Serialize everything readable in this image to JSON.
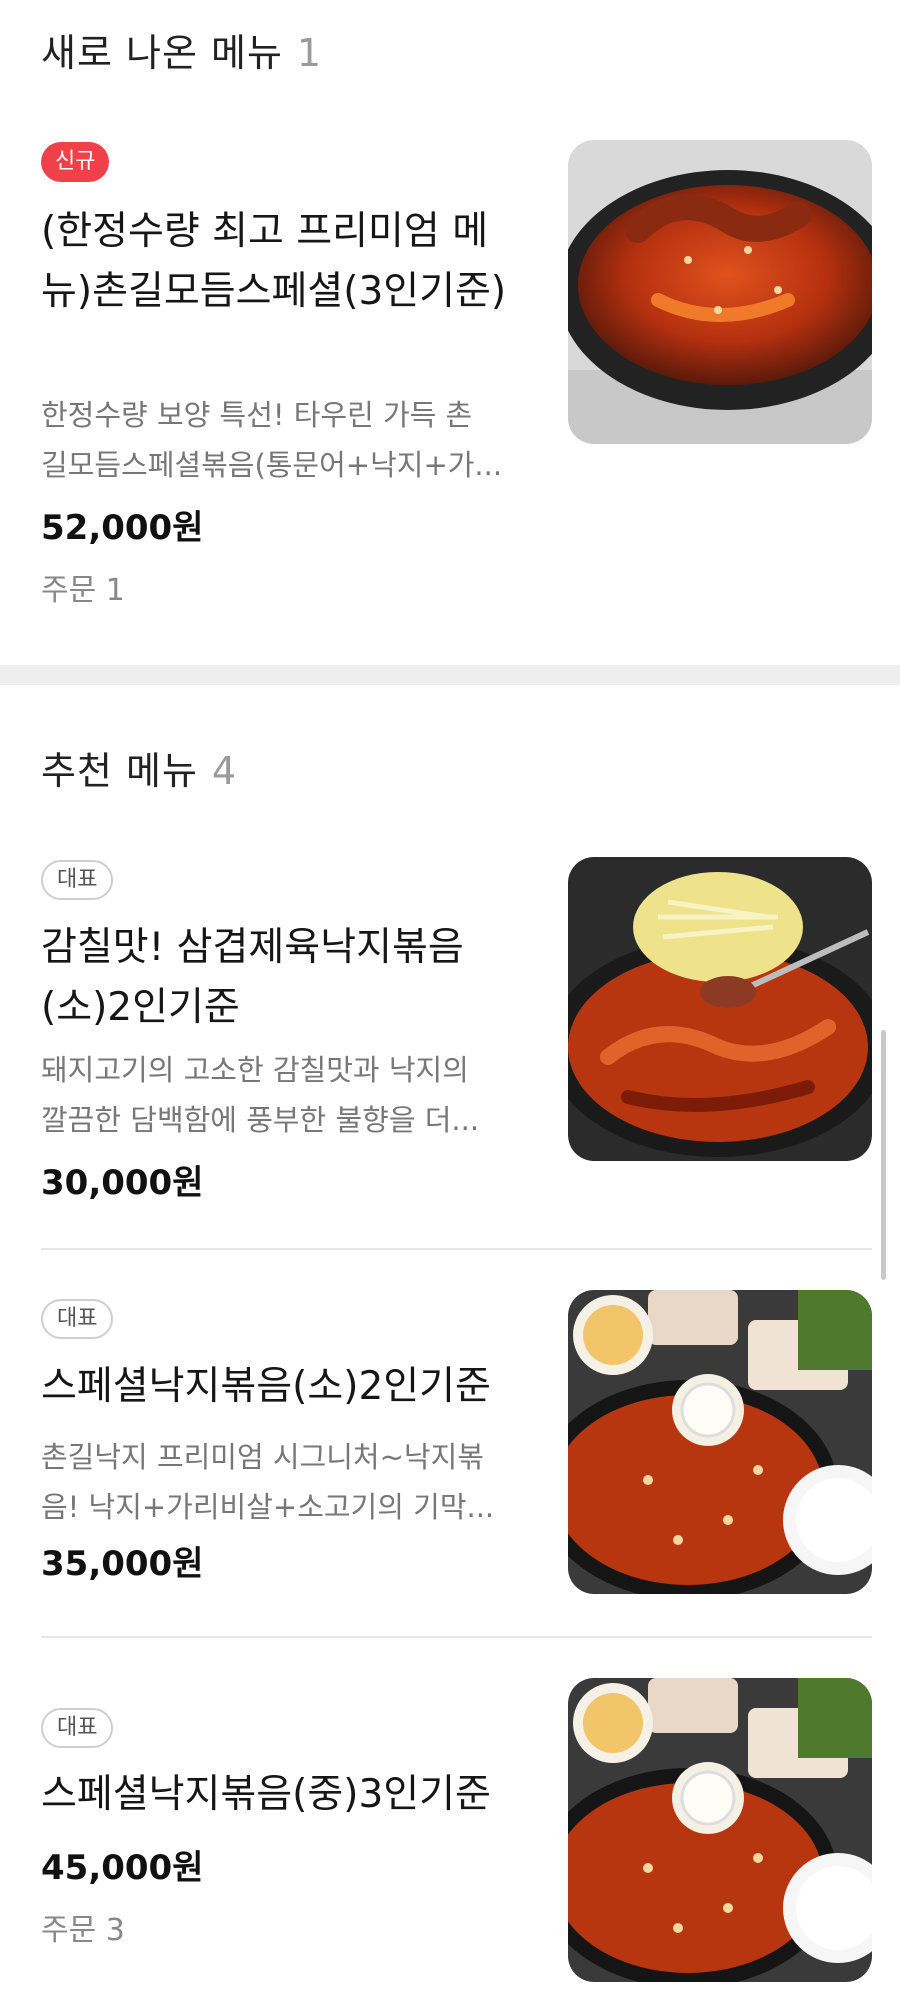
{
  "sections": [
    {
      "title": "새로 나온 메뉴",
      "count": "1",
      "items": [
        {
          "badge": "신규",
          "name": "(한정수량 최고 프리미엄 메뉴)촌길모듬스페셜(3인기준)",
          "desc_line1": "한정수량 보양 특선! 타우린 가득 촌",
          "desc_line2": "길모듬스페셜볶음(통문어+낙지+가...",
          "price": "52,000원",
          "orders": "주문 1",
          "image": "octopus-stir-fry-photo"
        }
      ]
    },
    {
      "title": "추천 메뉴",
      "count": "4",
      "items": [
        {
          "badge": "대표",
          "name": "감칠맛! 삼겹제육낙지볶음(소)2인기준",
          "desc_line1": "돼지고기의 고소한 감칠맛과 낙지의",
          "desc_line2": "깔끔한 담백함에 풍부한 불향을 더...",
          "price": "30,000원",
          "image": "pork-octopus-bean-sprouts-photo"
        },
        {
          "badge": "대표",
          "name": "스페셜낙지볶음(소)2인기준",
          "desc_line1": "촌길낙지 프리미엄 시그니처~낙지볶",
          "desc_line2": "음! 낙지+가리비살+소고기의 기막...",
          "price": "35,000원",
          "image": "special-octopus-set-photo"
        },
        {
          "badge": "대표",
          "name": "스페셜낙지볶음(중)3인기준",
          "price": "45,000원",
          "orders": "주문 3",
          "image": "special-octopus-set-photo"
        }
      ]
    }
  ],
  "colors": {
    "new_badge": "#f0414b",
    "section_band": "#eeeeee",
    "count_gray": "#9a9a9a"
  }
}
